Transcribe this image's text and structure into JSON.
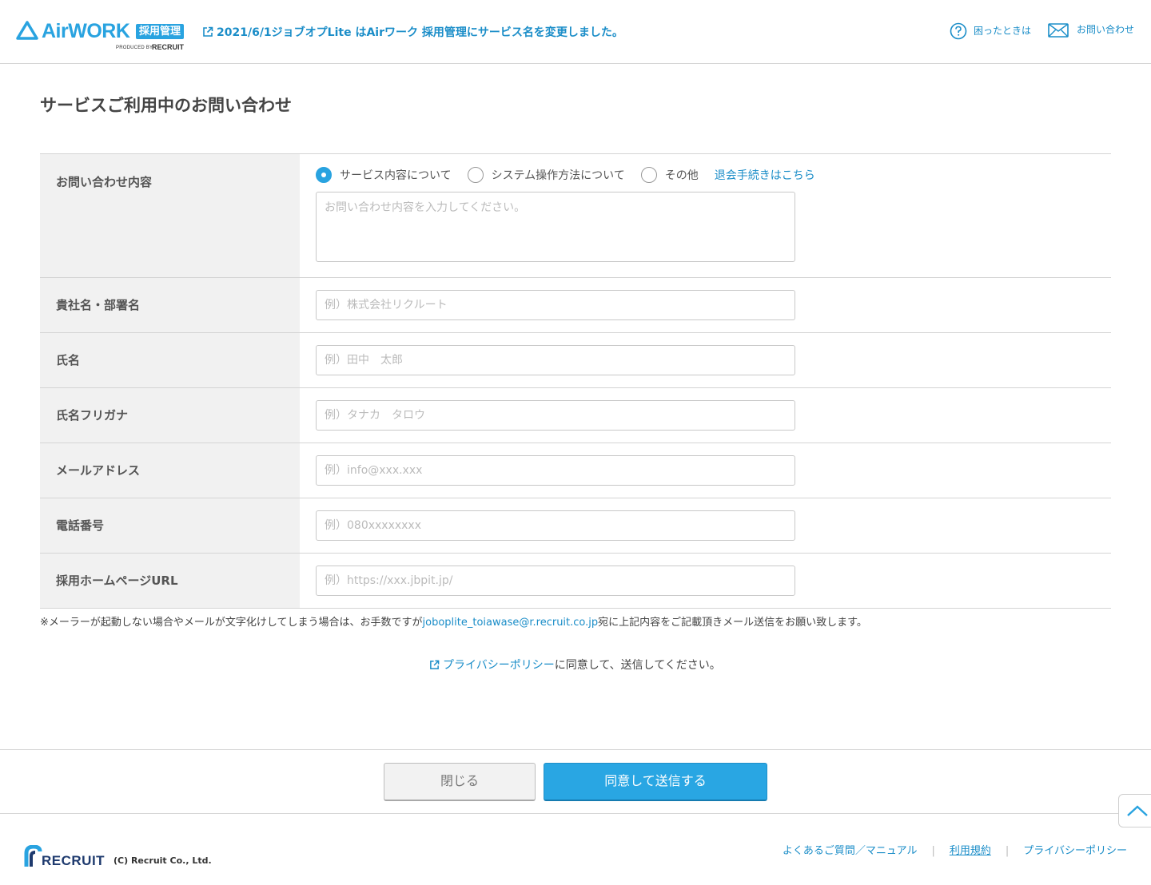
{
  "header": {
    "logo_text": "AirWORK",
    "logo_badge": "採用管理",
    "logo_produced_by": "PRODUCED BY",
    "logo_recruit": "RECRUIT",
    "announcement": "2021/6/1ジョブオプLite はAirワーク 採用管理にサービス名を変更しました。",
    "help_label": "困ったときは",
    "contact_label": "お問い合わせ"
  },
  "page": {
    "title": "サービスご利用中のお問い合わせ"
  },
  "form": {
    "inquiry": {
      "label": "お問い合わせ内容",
      "options": [
        "サービス内容について",
        "システム操作方法について",
        "その他"
      ],
      "selected": "サービス内容について",
      "withdraw_link": "退会手続きはこちら",
      "placeholder": "お問い合わせ内容を入力してください。"
    },
    "company": {
      "label": "貴社名・部署名",
      "placeholder": "例）株式会社リクルート"
    },
    "name": {
      "label": "氏名",
      "placeholder": "例）田中　太郎"
    },
    "furigana": {
      "label": "氏名フリガナ",
      "placeholder": "例）タナカ　タロウ"
    },
    "email": {
      "label": "メールアドレス",
      "placeholder": "例）info@xxx.xxx"
    },
    "phone": {
      "label": "電話番号",
      "placeholder": "例）080xxxxxxxx"
    },
    "homepage": {
      "label": "採用ホームページURL",
      "placeholder": "例）https://xxx.jbpit.jp/"
    }
  },
  "notes": {
    "mail_prefix": "※メーラーが起動しない場合やメールが文字化けしてしまう場合は、お手数ですが",
    "mail_address": "joboplite_toiawase@r.recruit.co.jp",
    "mail_suffix": "宛に上記内容をご記載頂きメール送信をお願い致します。",
    "privacy_link": "プライバシーポリシー",
    "privacy_suffix": "に同意して、送信してください。"
  },
  "actions": {
    "close_label": "閉じる",
    "submit_label": "同意して送信する"
  },
  "footer": {
    "recruit": "RECRUIT",
    "copyright": "(C) Recruit Co., Ltd.",
    "links": [
      "よくあるご質問／マニュアル",
      "利用規約",
      "プライバシーポリシー"
    ],
    "separator": "|"
  },
  "colors": {
    "accent": "#29a3e0",
    "link": "#1a8dc8",
    "label_bg": "#f1f1f1"
  }
}
